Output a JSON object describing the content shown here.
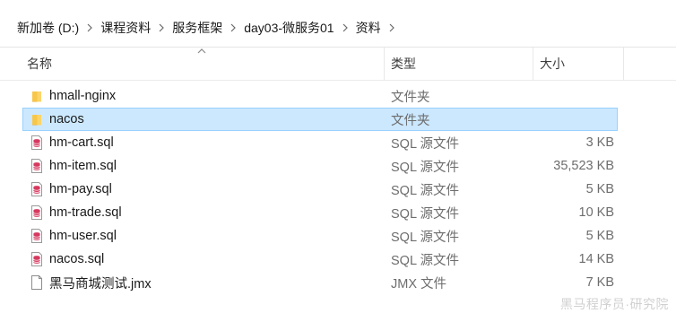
{
  "breadcrumb": [
    "新加卷 (D:)",
    "课程资料",
    "服务框架",
    "day03-微服务01",
    "资料"
  ],
  "columns": {
    "name": "名称",
    "type": "类型",
    "size": "大小",
    "sorted_by": "name"
  },
  "files": [
    {
      "name": "hmall-nginx",
      "type": "文件夹",
      "size": "",
      "icon": "folder-icon",
      "selected": false
    },
    {
      "name": "nacos",
      "type": "文件夹",
      "size": "",
      "icon": "folder-icon",
      "selected": true
    },
    {
      "name": "hm-cart.sql",
      "type": "SQL 源文件",
      "size": "3 KB",
      "icon": "sql-file-icon",
      "selected": false
    },
    {
      "name": "hm-item.sql",
      "type": "SQL 源文件",
      "size": "35,523 KB",
      "icon": "sql-file-icon",
      "selected": false
    },
    {
      "name": "hm-pay.sql",
      "type": "SQL 源文件",
      "size": "5 KB",
      "icon": "sql-file-icon",
      "selected": false
    },
    {
      "name": "hm-trade.sql",
      "type": "SQL 源文件",
      "size": "10 KB",
      "icon": "sql-file-icon",
      "selected": false
    },
    {
      "name": "hm-user.sql",
      "type": "SQL 源文件",
      "size": "5 KB",
      "icon": "sql-file-icon",
      "selected": false
    },
    {
      "name": "nacos.sql",
      "type": "SQL 源文件",
      "size": "14 KB",
      "icon": "sql-file-icon",
      "selected": false
    },
    {
      "name": "黑马商城测试.jmx",
      "type": "JMX 文件",
      "size": "7 KB",
      "icon": "blank-file-icon",
      "selected": false
    }
  ],
  "watermark": "黑马程序员·研究院",
  "colors": {
    "selection_bg": "#cce8ff",
    "selection_border": "#99d1ff",
    "folder": "#f8c74a",
    "sql_icon": "#d6395f",
    "secondary_text": "#6d6d6d"
  }
}
